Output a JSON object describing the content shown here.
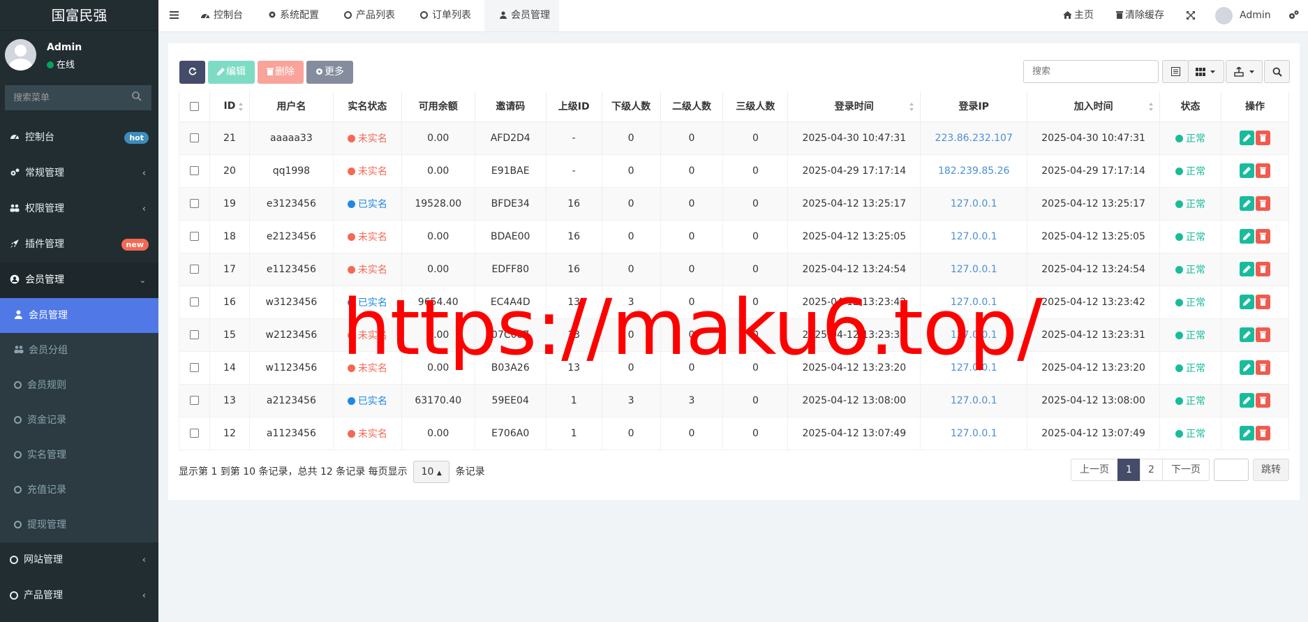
{
  "sidebar": {
    "logo": "国富民强",
    "user_name": "Admin",
    "user_status": "在线",
    "search_placeholder": "搜索菜单",
    "menu": [
      {
        "label": "控制台",
        "icon": "dashboard-icon",
        "badge": "hot",
        "badge_color": "#3c8dbc"
      },
      {
        "label": "常规管理",
        "icon": "cogs-icon"
      },
      {
        "label": "权限管理",
        "icon": "group-icon"
      },
      {
        "label": "插件管理",
        "icon": "rocket-icon",
        "badge": "new",
        "badge_color": "#f56954"
      },
      {
        "label": "会员管理",
        "icon": "user-circle-icon"
      }
    ],
    "submenu": [
      "会员管理",
      "会员分组",
      "会员规则",
      "资金记录",
      "实名管理",
      "充值记录",
      "提现管理"
    ],
    "menu_after": [
      {
        "label": "网站管理"
      },
      {
        "label": "产品管理"
      }
    ]
  },
  "topbar": {
    "tabs": [
      "控制台",
      "系统配置",
      "产品列表",
      "订单列表",
      "会员管理"
    ],
    "home": "主页",
    "clear_cache": "清除缓存",
    "admin": "Admin"
  },
  "toolbar": {
    "edit": "编辑",
    "delete": "删除",
    "more": "更多",
    "search_placeholder": "搜索"
  },
  "table": {
    "headers": [
      "ID",
      "用户名",
      "实名状态",
      "可用余额",
      "邀请码",
      "上级ID",
      "下级人数",
      "二级人数",
      "三级人数",
      "登录时间",
      "登录IP",
      "加入时间",
      "状态",
      "操作"
    ],
    "rows": [
      [
        "21",
        "aaaaa33",
        "未实名",
        "0.00",
        "AFD2D4",
        "-",
        "0",
        "0",
        "0",
        "2025-04-30 10:47:31",
        "223.86.232.107",
        "2025-04-30 10:47:31",
        "正常"
      ],
      [
        "20",
        "qq1998",
        "未实名",
        "0.00",
        "E91BAE",
        "-",
        "0",
        "0",
        "0",
        "2025-04-29 17:17:14",
        "182.239.85.26",
        "2025-04-29 17:17:14",
        "正常"
      ],
      [
        "19",
        "e3123456",
        "已实名",
        "19528.00",
        "BFDE34",
        "16",
        "0",
        "0",
        "0",
        "2025-04-12 13:25:17",
        "127.0.0.1",
        "2025-04-12 13:25:17",
        "正常"
      ],
      [
        "18",
        "e2123456",
        "未实名",
        "0.00",
        "BDAE00",
        "16",
        "0",
        "0",
        "0",
        "2025-04-12 13:25:05",
        "127.0.0.1",
        "2025-04-12 13:25:05",
        "正常"
      ],
      [
        "17",
        "e1123456",
        "未实名",
        "0.00",
        "EDFF80",
        "16",
        "0",
        "0",
        "0",
        "2025-04-12 13:24:54",
        "127.0.0.1",
        "2025-04-12 13:24:54",
        "正常"
      ],
      [
        "16",
        "w3123456",
        "已实名",
        "9654.40",
        "EC4A4D",
        "13",
        "3",
        "0",
        "0",
        "2025-04-12 13:23:42",
        "127.0.0.1",
        "2025-04-12 13:23:42",
        "正常"
      ],
      [
        "15",
        "w2123456",
        "未实名",
        "0.00",
        "07C087",
        "13",
        "0",
        "0",
        "0",
        "2025-04-12 13:23:31",
        "127.0.0.1",
        "2025-04-12 13:23:31",
        "正常"
      ],
      [
        "14",
        "w1123456",
        "未实名",
        "0.00",
        "B03A26",
        "13",
        "0",
        "0",
        "0",
        "2025-04-12 13:23:20",
        "127.0.0.1",
        "2025-04-12 13:23:20",
        "正常"
      ],
      [
        "13",
        "a2123456",
        "已实名",
        "63170.40",
        "59EE04",
        "1",
        "3",
        "3",
        "0",
        "2025-04-12 13:08:00",
        "127.0.0.1",
        "2025-04-12 13:08:00",
        "正常"
      ],
      [
        "12",
        "a1123456",
        "未实名",
        "0.00",
        "E706A0",
        "1",
        "0",
        "0",
        "0",
        "2025-04-12 13:07:49",
        "127.0.0.1",
        "2025-04-12 13:07:49",
        "正常"
      ]
    ]
  },
  "footer": {
    "info": "显示第 1 到第 10 条记录，总共 12 条记录 每页显示",
    "page_size": "10",
    "info_suffix": "条记录",
    "prev": "上一页",
    "pages": [
      "1",
      "2"
    ],
    "next": "下一页",
    "jump": "跳转"
  },
  "watermark": "https://maku6.top/",
  "colors": {
    "verified": "#1e88e5",
    "unverified": "#f56954",
    "normal": "#18bc9c",
    "active_submenu": "#5078e6"
  }
}
